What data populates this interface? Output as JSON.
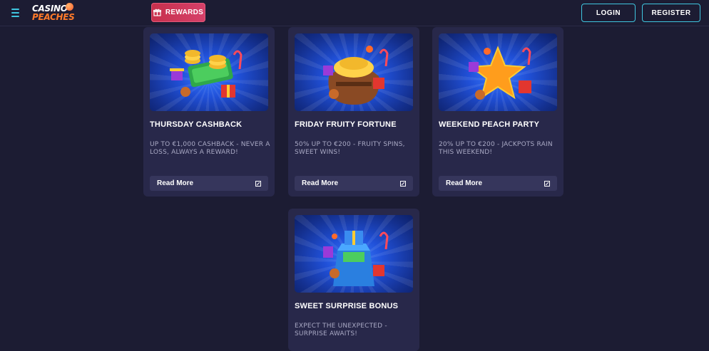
{
  "header": {
    "menu_icon": "hamburger-icon",
    "logo_line1": "CASINO",
    "logo_line2": "PEACHES",
    "rewards_label": "REWARDS",
    "rewards_icon": "gift-icon",
    "login_label": "LOGIN",
    "register_label": "REGISTER"
  },
  "colors": {
    "background": "#1c1c33",
    "card": "#28284a",
    "accent": "#3fc6e0",
    "rewards": "#c7304c"
  },
  "promotions": [
    {
      "title": "THURSDAY CASHBACK",
      "description": "UP TO €1,000 CASHBACK - NEVER A LOSS, ALWAYS A REWARD!",
      "button": "Read More",
      "image": "coins-and-cash-illustration"
    },
    {
      "title": "FRIDAY FRUITY FORTUNE",
      "description": "50% UP TO €200 - FRUITY SPINS, SWEET WINS!",
      "button": "Read More",
      "image": "treasure-sack-illustration"
    },
    {
      "title": "WEEKEND PEACH PARTY",
      "description": "20% UP TO €200 - JACKPOTS RAIN THIS WEEKEND!",
      "button": "Read More",
      "image": "golden-star-illustration"
    },
    {
      "title": "SWEET SURPRISE BONUS",
      "description": "EXPECT THE UNEXPECTED - SURPRISE AWAITS!",
      "button": "Read More",
      "image": "gift-box-illustration"
    }
  ]
}
